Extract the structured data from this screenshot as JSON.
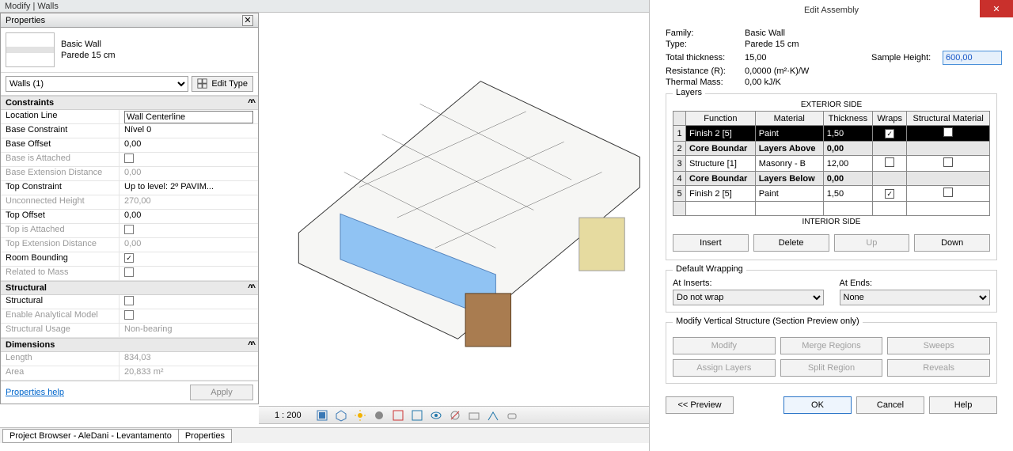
{
  "ribbon": {
    "tab_label": "Modify | Walls"
  },
  "properties": {
    "title": "Properties",
    "type_family": "Basic Wall",
    "type_name": "Parede 15 cm",
    "selector": "Walls (1)",
    "edit_type": "Edit Type",
    "groups": {
      "constraints": {
        "header": "Constraints",
        "location_line_label": "Location Line",
        "location_line_value": "Wall Centerline",
        "base_constraint_label": "Base Constraint",
        "base_constraint_value": "Nível 0",
        "base_offset_label": "Base Offset",
        "base_offset_value": "0,00",
        "base_attached_label": "Base is Attached",
        "base_ext_label": "Base Extension Distance",
        "base_ext_value": "0,00",
        "top_constraint_label": "Top Constraint",
        "top_constraint_value": "Up to level: 2º PAVIM...",
        "unconn_height_label": "Unconnected Height",
        "unconn_height_value": "270,00",
        "top_offset_label": "Top Offset",
        "top_offset_value": "0,00",
        "top_attached_label": "Top is Attached",
        "top_ext_label": "Top Extension Distance",
        "top_ext_value": "0,00",
        "room_bounding_label": "Room Bounding",
        "related_mass_label": "Related to Mass"
      },
      "structural": {
        "header": "Structural",
        "structural_label": "Structural",
        "enable_analytical_label": "Enable Analytical Model",
        "usage_label": "Structural Usage",
        "usage_value": "Non-bearing"
      },
      "dimensions": {
        "header": "Dimensions",
        "length_label": "Length",
        "length_value": "834,03",
        "area_label": "Area",
        "area_value": "20,833 m²"
      }
    },
    "help_link": "Properties help",
    "apply": "Apply"
  },
  "bottom_tabs": {
    "tab1": "Project Browser - AleDani - Levantamento",
    "tab2": "Properties"
  },
  "viewbar": {
    "scale": "1 : 200"
  },
  "dialog": {
    "title": "Edit Assembly",
    "close": "✕",
    "info": {
      "family_l": "Family:",
      "family_v": "Basic Wall",
      "type_l": "Type:",
      "type_v": "Parede 15 cm",
      "thick_l": "Total thickness:",
      "thick_v": "15,00",
      "resist_l": "Resistance (R):",
      "resist_v": "0,0000 (m²·K)/W",
      "mass_l": "Thermal Mass:",
      "mass_v": "0,00 kJ/K",
      "sample_l": "Sample Height:",
      "sample_v": "600,00"
    },
    "layers": {
      "legend": "Layers",
      "ext_side": "EXTERIOR SIDE",
      "int_side": "INTERIOR SIDE",
      "h_function": "Function",
      "h_material": "Material",
      "h_thickness": "Thickness",
      "h_wraps": "Wraps",
      "h_struct": "Structural Material",
      "rows": [
        {
          "n": "1",
          "func": "Finish 2 [5]",
          "mat": "Paint",
          "thk": "1,50",
          "wraps": true,
          "struct": false,
          "bold": false,
          "sel": true
        },
        {
          "n": "2",
          "func": "Core Boundar",
          "mat": "Layers Above",
          "thk": "0,00",
          "wraps": null,
          "struct": null,
          "bold": true,
          "sel": false
        },
        {
          "n": "3",
          "func": "Structure [1]",
          "mat": "Masonry - B",
          "thk": "12,00",
          "wraps": false,
          "struct": false,
          "bold": false,
          "sel": false
        },
        {
          "n": "4",
          "func": "Core Boundar",
          "mat": "Layers Below",
          "thk": "0,00",
          "wraps": null,
          "struct": null,
          "bold": true,
          "sel": false
        },
        {
          "n": "5",
          "func": "Finish 2 [5]",
          "mat": "Paint",
          "thk": "1,50",
          "wraps": true,
          "struct": false,
          "bold": false,
          "sel": false
        }
      ],
      "insert": "Insert",
      "delete": "Delete",
      "up": "Up",
      "down": "Down"
    },
    "wrap": {
      "legend": "Default Wrapping",
      "at_inserts_l": "At Inserts:",
      "at_inserts_v": "Do not wrap",
      "at_ends_l": "At Ends:",
      "at_ends_v": "None"
    },
    "vstruct": {
      "legend": "Modify Vertical Structure (Section Preview only)",
      "modify": "Modify",
      "merge": "Merge Regions",
      "sweeps": "Sweeps",
      "assign": "Assign Layers",
      "split": "Split Region",
      "reveals": "Reveals"
    },
    "footer": {
      "preview": "<< Preview",
      "ok": "OK",
      "cancel": "Cancel",
      "help": "Help"
    }
  }
}
